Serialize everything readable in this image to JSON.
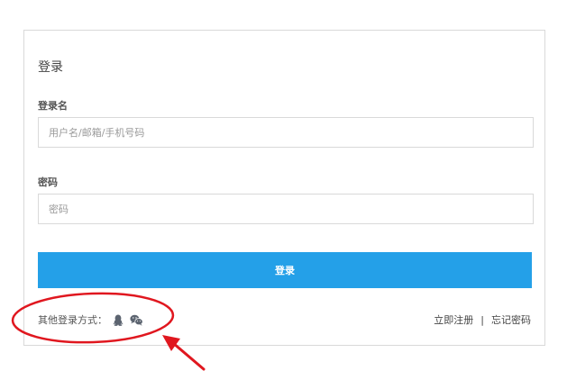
{
  "login": {
    "title": "登录",
    "username_label": "登录名",
    "username_placeholder": "用户名/邮箱/手机号码",
    "password_label": "密码",
    "password_placeholder": "密码",
    "submit_label": "登录"
  },
  "other": {
    "label": "其他登录方式：",
    "icons": [
      "qq-icon",
      "wechat-icon"
    ],
    "icon_color": "#5c6470"
  },
  "links": {
    "register": "立即注册",
    "separator": "|",
    "forgot": "忘记密码"
  },
  "colors": {
    "primary": "#24a0e8",
    "annotation": "#e0171f"
  }
}
